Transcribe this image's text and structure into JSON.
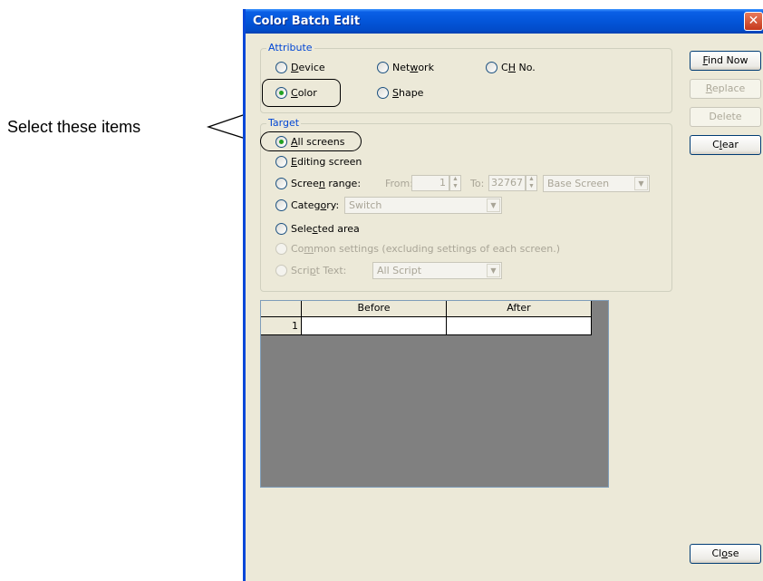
{
  "callout": {
    "text": "Select these items"
  },
  "window": {
    "title": "Color Batch Edit",
    "close_glyph": "✕"
  },
  "attribute": {
    "legend": "Attribute",
    "options": [
      {
        "id": "device",
        "label_u": "D",
        "label_rest": "evice",
        "checked": false
      },
      {
        "id": "network",
        "label_pre": "Net",
        "label_u": "w",
        "label_rest": "ork",
        "checked": false
      },
      {
        "id": "chno",
        "label_pre": "C",
        "label_u": "H",
        "label_rest": " No.",
        "checked": false
      },
      {
        "id": "color",
        "label_u": "C",
        "label_rest": "olor",
        "checked": true
      },
      {
        "id": "shape",
        "label_u": "S",
        "label_rest": "hape",
        "checked": false
      }
    ]
  },
  "target": {
    "legend": "Target",
    "all_screens": {
      "u": "A",
      "rest": "ll screens",
      "checked": true
    },
    "editing_screen": {
      "u": "E",
      "rest": "diting screen"
    },
    "screen_range": {
      "pre": "Scree",
      "u": "n",
      "rest": " range:",
      "from_label": "From:",
      "from_value": "1",
      "to_label": "To:",
      "to_value": "32767",
      "screen_type": "Base Screen"
    },
    "category": {
      "pre": "Categ",
      "u": "o",
      "rest": "ry:",
      "value": "Switch"
    },
    "selected_area": {
      "pre": "Sele",
      "u": "c",
      "rest": "ted area"
    },
    "common_settings": {
      "pre": "Co",
      "u": "m",
      "rest": "mon settings (excluding settings of each screen.)"
    },
    "script_text": {
      "pre": "Scri",
      "u": "p",
      "rest": "t Text:",
      "value": "All Script"
    }
  },
  "buttons": {
    "find_now": {
      "u": "F",
      "rest": "ind Now"
    },
    "replace": {
      "u": "R",
      "rest": "eplace"
    },
    "delete": {
      "label": "Delete"
    },
    "clear": {
      "pre": "C",
      "u": "l",
      "rest": "ear"
    },
    "close": {
      "pre": "Cl",
      "u": "o",
      "rest": "se"
    }
  },
  "table": {
    "columns": [
      "Before",
      "After"
    ],
    "rows": [
      {
        "num": "1",
        "before": "",
        "after": ""
      }
    ]
  },
  "colors": {
    "title_bar": "#0355d9",
    "dialog_bg": "#ece9d8",
    "group_label": "#0046d5",
    "grid_bg": "#808080"
  }
}
